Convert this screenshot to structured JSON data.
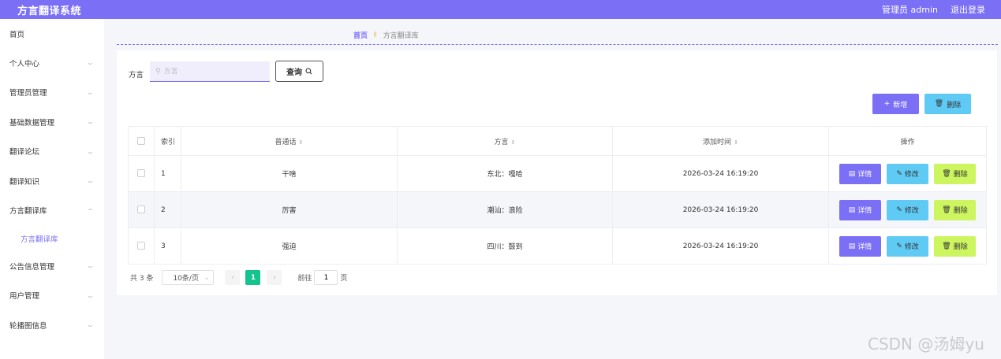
{
  "header": {
    "brand": "方言翻译系统",
    "user": "管理员 admin",
    "logout": "退出登录"
  },
  "sidebar": {
    "items": [
      {
        "label": "首页",
        "expandable": false
      },
      {
        "label": "个人中心",
        "expandable": true
      },
      {
        "label": "管理员管理",
        "expandable": true
      },
      {
        "label": "基础数据管理",
        "expandable": true
      },
      {
        "label": "翻译论坛",
        "expandable": true
      },
      {
        "label": "翻译知识",
        "expandable": true
      },
      {
        "label": "方言翻译库",
        "expandable": true,
        "expanded": true
      },
      {
        "label": "公告信息管理",
        "expandable": true
      },
      {
        "label": "用户管理",
        "expandable": true
      },
      {
        "label": "轮播图信息",
        "expandable": true
      }
    ],
    "sub_item": "方言翻译库"
  },
  "breadcrumb": {
    "home": "首页",
    "current": "方言翻译库"
  },
  "search": {
    "label": "方言",
    "placeholder": "方言",
    "button": "查询"
  },
  "actions": {
    "add": "新增",
    "delete": "删除"
  },
  "table": {
    "headers": {
      "index": "索引",
      "mandarin": "普通话",
      "dialect": "方言",
      "added_time": "添加时间",
      "ops": "操作"
    },
    "rows": [
      {
        "index": "1",
        "mandarin": "干啥",
        "dialect": "东北：嘎哈",
        "added_time": "2026-03-24 16:19:20"
      },
      {
        "index": "2",
        "mandarin": "厉害",
        "dialect": "潮汕：浪险",
        "added_time": "2026-03-24 16:19:20"
      },
      {
        "index": "3",
        "mandarin": "强迫",
        "dialect": "四川：鼓到",
        "added_time": "2026-03-24 16:19:20"
      }
    ],
    "row_buttons": {
      "detail": "详情",
      "edit": "修改",
      "remove": "删除"
    }
  },
  "pagination": {
    "total": "共 3 条",
    "page_size": "10条/页",
    "current_page": "1",
    "goto_label": "前往",
    "goto_value": "1",
    "goto_suffix": "页"
  },
  "watermark": "CSDN @汤姆yu",
  "colors": {
    "primary": "#7a6ff5",
    "info": "#5fcbf5",
    "lime": "#ccf55f",
    "pager_active": "#14c38e"
  }
}
